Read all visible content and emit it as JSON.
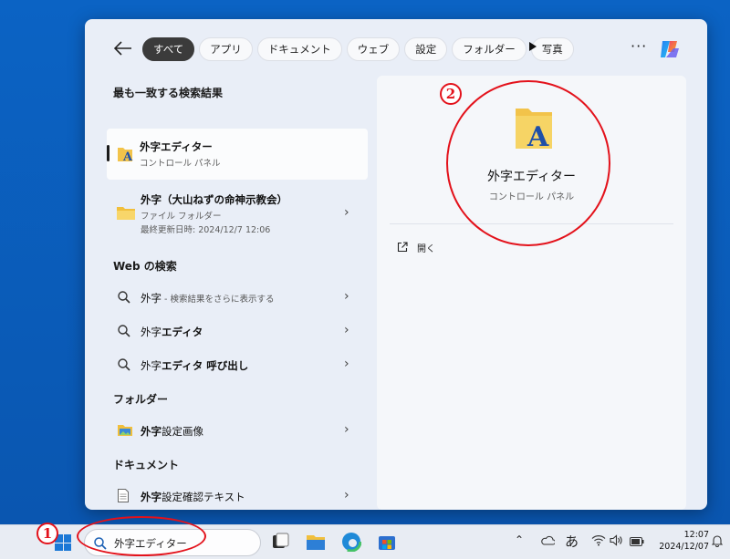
{
  "filters": {
    "tabs": [
      "すべて",
      "アプリ",
      "ドキュメント",
      "ウェブ",
      "設定",
      "フォルダー",
      "写真"
    ],
    "active": "すべて"
  },
  "best_match": {
    "heading": "最も一致する検索結果",
    "title": "外字エディター",
    "subtitle": "コントロール パネル"
  },
  "folder_result": {
    "title": "外字（大山ねずの命神示教会）",
    "type": "ファイル フォルダー",
    "modified": "最終更新日時: 2024/12/7 12:06"
  },
  "web": {
    "heading": "Web の検索",
    "items": [
      {
        "prefix": "外字",
        "hint": " - 検索結果をさらに表示する"
      },
      {
        "prefix": "外字",
        "suffix": "エディタ"
      },
      {
        "prefix": "外字",
        "suffix": "エディタ 呼び出し"
      }
    ]
  },
  "folders": {
    "heading": "フォルダー",
    "items": [
      {
        "prefix": "外字",
        "rest": "設定画像"
      }
    ]
  },
  "documents": {
    "heading": "ドキュメント",
    "items": [
      {
        "prefix": "外字",
        "rest": "設定確認テキスト"
      }
    ]
  },
  "preview": {
    "title": "外字エディター",
    "subtitle": "コントロール パネル",
    "actions": [
      {
        "label": "開く"
      }
    ]
  },
  "annotations": {
    "badge_1": "1",
    "badge_2": "2",
    "color": "#e3121b"
  },
  "taskbar": {
    "search_value": "外字エディター",
    "ime_indicator": "あ",
    "time": "12:07",
    "date": "2024/12/07"
  },
  "icons": [
    "back-arrow-icon",
    "play-icon",
    "more-icon",
    "copilot-icon",
    "app-icon",
    "folder-icon",
    "search-icon",
    "image-icon",
    "document-icon",
    "chevron-right-icon",
    "open-external-icon",
    "windows-start-icon",
    "task-view-icon",
    "file-explorer-icon",
    "edge-icon",
    "store-icon",
    "chevron-up-icon",
    "onedrive-icon",
    "wifi-icon",
    "speaker-icon",
    "battery-icon",
    "bell-icon"
  ]
}
